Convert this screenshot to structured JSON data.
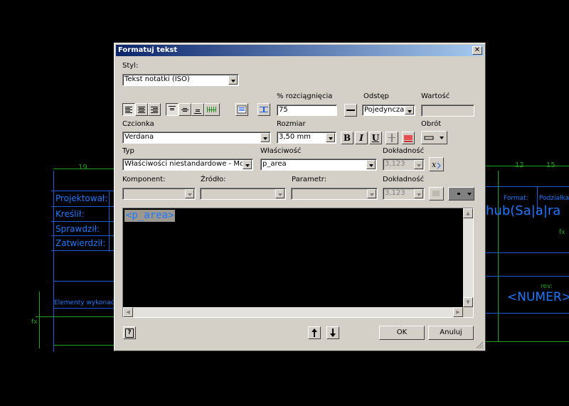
{
  "background": {
    "title_labels": [
      "Projektował:",
      "Kreślił:",
      "Sprawdził:",
      "Zatwierdził:"
    ],
    "dim_19": "19",
    "dim_12": "12",
    "dim_15": "15",
    "green_note": "Elementy wykonać z",
    "right_text_big": "<NUMER>W",
    "format_label": "Format:",
    "podzialka_label": "Podziałka",
    "rev_label": "rev:",
    "fx_label": "fx",
    "big_text_right": "hub(Sa|a|ra"
  },
  "dialog": {
    "title": "Formatuj tekst",
    "close": "✕",
    "style_label": "Styl:",
    "style_value": "Tekst notatki (ISO)",
    "stretch_label": "% rozciągnięcia",
    "stretch_value": "75",
    "spacing_label": "Odstęp",
    "spacing_value": "Pojedyncza",
    "value_label": "Wartość",
    "value_value": "",
    "font_label": "Czcionka",
    "font_value": "Verdana",
    "size_label": "Rozmiar",
    "size_value": "3,50 mm",
    "rotation_label": "Obrót",
    "type_label": "Typ",
    "type_value": "Właściwości niestandardowe - Mod",
    "property_label": "Właściwość",
    "property_value": "p_area",
    "precision_label": "Dokładność",
    "precision_value": "3,123",
    "component_label": "Komponent:",
    "source_label": "Źródło:",
    "parameter_label": "Parametr:",
    "precision2_label": "Dokładność",
    "precision2_value": "3,123",
    "bold": "B",
    "italic": "I",
    "underline": "U",
    "editor_text": "<p_area>",
    "ok": "OK",
    "cancel": "Anuluj",
    "help": "?"
  }
}
